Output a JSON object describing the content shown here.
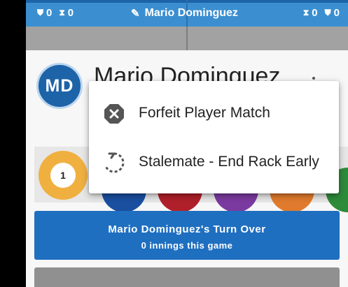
{
  "topbar": {
    "left_shield_count": "0",
    "left_hourglass_count": "0",
    "player_label": "Mario Dominguez",
    "right_hourglass_count": "0",
    "right_shield_count": "0"
  },
  "player": {
    "initials": "MD",
    "name": "Mario Dominguez"
  },
  "balls": {
    "one_number": "1"
  },
  "menu": {
    "items": [
      {
        "label": "Forfeit Player Match",
        "icon": "forfeit-octagon-x-icon"
      },
      {
        "label": "Stalemate - End Rack Early",
        "icon": "stalemate-dashed-rotate-icon"
      }
    ]
  },
  "turn_banner": {
    "title": "Mario Dominguez's Turn Over",
    "subtitle": "0 innings this game"
  },
  "colors": {
    "topbar": "#3b8fd0",
    "topbar_accent": "#1d63a8",
    "avatar": "#1d63a8",
    "turn_banner": "#1f6fc0",
    "ball_one": "#f0b040",
    "subbar": "#a2a2a2"
  }
}
